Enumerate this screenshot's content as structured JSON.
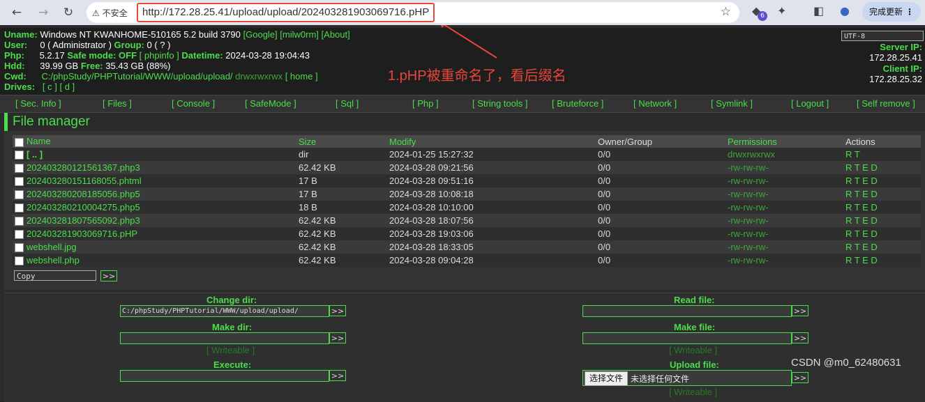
{
  "browser": {
    "insecure_label": "不安全",
    "url": "http://172.28.25.41/upload/upload/202403281903069716.pHP",
    "extension_badge": "6",
    "update_label": "完成更新"
  },
  "info": {
    "uname_label": "Uname:",
    "uname_value": "Windows NT KWANHOME-510165 5.2 build 3790",
    "uname_links": [
      "[Google]",
      "[milw0rm]",
      "[About]"
    ],
    "user_label": "User:",
    "user_value": "0 ( Administrator )",
    "group_label": "Group:",
    "group_value": "0 ( ? )",
    "php_label": "Php:",
    "php_value": "5.2.17",
    "safemode_label": "Safe mode:",
    "safemode_value": "OFF",
    "phpinfo_link": "[ phpinfo ]",
    "datetime_label": "Datetime:",
    "datetime_value": "2024-03-28 19:04:43",
    "hdd_label": "Hdd:",
    "hdd_value": "39.99 GB",
    "free_label": "Free:",
    "free_value": "35.43 GB (88%)",
    "cwd_label": "Cwd:",
    "cwd_value": "C:/phpStudy/PHPTutorial/WWW/upload/upload/",
    "cwd_perm": "drwxrwxrwx",
    "home_link": "[ home ]",
    "drives_label": "Drives:",
    "drives_value": "[ c ] [ d ]",
    "charset": "UTF-8",
    "server_ip_label": "Server IP:",
    "server_ip": "172.28.25.41",
    "client_ip_label": "Client IP:",
    "client_ip": "172.28.25.32"
  },
  "annotation": "1.pHP被重命名了，看后缀名",
  "menu": [
    "[ Sec. Info ]",
    "[ Files ]",
    "[ Console ]",
    "[ SafeMode ]",
    "[ Sql ]",
    "[ Php ]",
    "[ String tools ]",
    "[ Bruteforce ]",
    "[ Network ]",
    "[ Symlink ]",
    "[ Logout ]",
    "[ Self remove ]"
  ],
  "file_manager": {
    "title": "File manager",
    "columns": [
      "Name",
      "Size",
      "Modify",
      "Owner/Group",
      "Permissions",
      "Actions"
    ],
    "rows": [
      {
        "name": "[ .. ]",
        "size": "dir",
        "modify": "2024-01-25 15:27:32",
        "owner": "0/0",
        "perm": "drwxrwxrwx",
        "actions": "R T"
      },
      {
        "name": "202403280121561367.php3",
        "size": "62.42 KB",
        "modify": "2024-03-28 09:21:56",
        "owner": "0/0",
        "perm": "-rw-rw-rw-",
        "actions": "R T E D"
      },
      {
        "name": "202403280151168055.phtml",
        "size": "17 B",
        "modify": "2024-03-28 09:51:16",
        "owner": "0/0",
        "perm": "-rw-rw-rw-",
        "actions": "R T E D"
      },
      {
        "name": "202403280208185056.php5",
        "size": "17 B",
        "modify": "2024-03-28 10:08:18",
        "owner": "0/0",
        "perm": "-rw-rw-rw-",
        "actions": "R T E D"
      },
      {
        "name": "202403280210004275.php5",
        "size": "18 B",
        "modify": "2024-03-28 10:10:00",
        "owner": "0/0",
        "perm": "-rw-rw-rw-",
        "actions": "R T E D"
      },
      {
        "name": "202403281807565092.php3",
        "size": "62.42 KB",
        "modify": "2024-03-28 18:07:56",
        "owner": "0/0",
        "perm": "-rw-rw-rw-",
        "actions": "R T E D"
      },
      {
        "name": "202403281903069716.pHP",
        "size": "62.42 KB",
        "modify": "2024-03-28 19:03:06",
        "owner": "0/0",
        "perm": "-rw-rw-rw-",
        "actions": "R T E D"
      },
      {
        "name": "webshell.jpg",
        "size": "62.42 KB",
        "modify": "2024-03-28 18:33:05",
        "owner": "0/0",
        "perm": "-rw-rw-rw-",
        "actions": "R T E D"
      },
      {
        "name": "webshell.php",
        "size": "62.42 KB",
        "modify": "2024-03-28 09:04:28",
        "owner": "0/0",
        "perm": "-rw-rw-rw-",
        "actions": "R T E D"
      }
    ],
    "copy_option": "Copy",
    "go": ">>"
  },
  "forms": {
    "change_dir_label": "Change dir:",
    "change_dir_value": "C:/phpStudy/PHPTutorial/WWW/upload/upload/",
    "make_dir_label": "Make dir:",
    "execute_label": "Execute:",
    "read_file_label": "Read file:",
    "make_file_label": "Make file:",
    "upload_file_label": "Upload file:",
    "writeable": "[ Writeable ]",
    "choose_file": "选择文件",
    "no_file": "未选择任何文件",
    "go": ">>"
  },
  "watermark": "CSDN @m0_62480631"
}
